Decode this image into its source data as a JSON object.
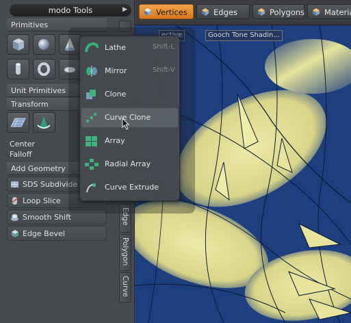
{
  "toolbox": {
    "title": "modo Tools",
    "sections": {
      "primitives": "Primitives",
      "unit_primitives": "Unit Primitives",
      "transform": "Transform",
      "add_geometry": "Add Geometry"
    },
    "center_label": "Center",
    "falloff_label": "Falloff",
    "tools": [
      {
        "label": "SDS Subdivide",
        "icon": "sds-subdivide-icon"
      },
      {
        "label": "Loop Slice",
        "icon": "loop-slice-icon"
      },
      {
        "label": "Smooth Shift",
        "icon": "smooth-shift-icon"
      },
      {
        "label": "Edge Bevel",
        "icon": "edge-bevel-icon"
      }
    ],
    "side_tabs": [
      "Edge",
      "Polygon",
      "Curve"
    ]
  },
  "selection_tabs": [
    {
      "label": "Vertices",
      "icon": "vertices-icon",
      "active": true
    },
    {
      "label": "Edges",
      "icon": "edges-icon",
      "active": false
    },
    {
      "label": "Polygons",
      "icon": "polygons-icon",
      "active": false
    },
    {
      "label": "Materia",
      "icon": "material-icon",
      "active": false
    }
  ],
  "viewport": {
    "view_label": "ective",
    "shading_label": "Gooch Tone Shadin..."
  },
  "popup_menu": {
    "hovered": "Curve Clone",
    "items": [
      {
        "label": "Lathe",
        "shortcut": "Shift-L",
        "icon": "lathe-icon"
      },
      {
        "label": "Mirror",
        "shortcut": "Shift-V",
        "icon": "mirror-icon"
      },
      {
        "label": "Clone",
        "shortcut": "",
        "icon": "clone-icon"
      },
      {
        "label": "Curve Clone",
        "shortcut": "",
        "icon": "curve-clone-icon"
      },
      {
        "label": "Array",
        "shortcut": "",
        "icon": "array-icon"
      },
      {
        "label": "Radial Array",
        "shortcut": "",
        "icon": "radial-array-icon"
      },
      {
        "label": "Curve Extrude",
        "shortcut": "",
        "icon": "curve-extrude-icon"
      }
    ]
  },
  "colors": {
    "active_tab": "#e88c2c",
    "viewport_blue": "#1b3d7e",
    "viewport_yellow": "#e6e39a"
  }
}
